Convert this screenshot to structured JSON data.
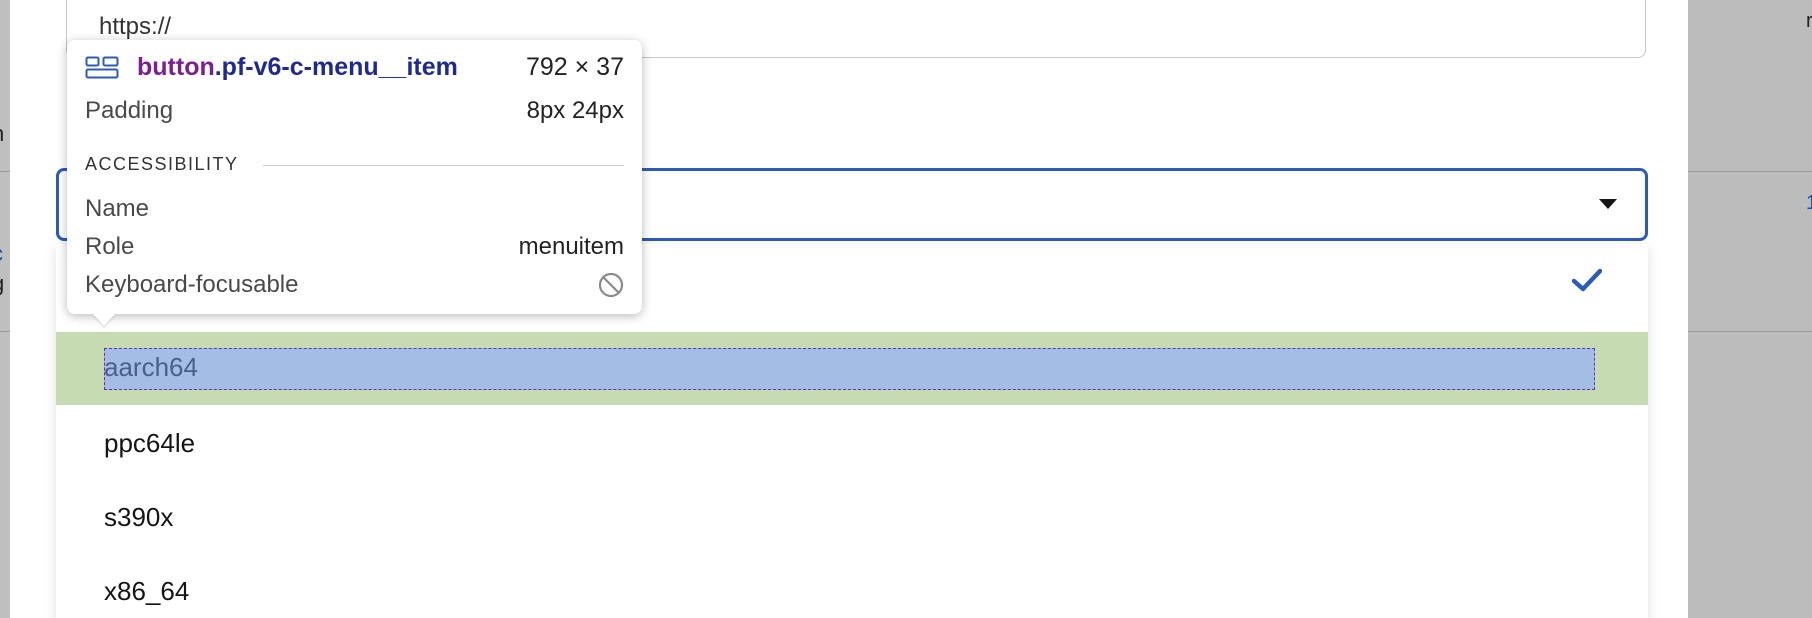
{
  "background": {
    "left_fragments": [
      "n",
      "c",
      "g"
    ],
    "right_fragments": [
      "r",
      "1"
    ]
  },
  "url_input": {
    "value": "https://"
  },
  "arch_select": {
    "selected_value": "",
    "options": [
      {
        "label": "",
        "selected": true
      },
      {
        "label": "aarch64",
        "selected": false,
        "highlighted": true
      },
      {
        "label": "ppc64le",
        "selected": false
      },
      {
        "label": "s390x",
        "selected": false
      },
      {
        "label": "x86_64",
        "selected": false
      }
    ]
  },
  "inspect_tooltip": {
    "selector_tag": "button",
    "selector_class": ".pf-v6-c-menu__item",
    "size": "792 × 37",
    "padding_label": "Padding",
    "padding_value": "8px 24px",
    "section_title": "ACCESSIBILITY",
    "name_label": "Name",
    "name_value": "",
    "role_label": "Role",
    "role_value": "menuitem",
    "focusable_label": "Keyboard-focusable",
    "focusable_icon": "not-allowed-icon"
  },
  "colors": {
    "focus_border": "#2d5bb8",
    "check": "#2d5bb8",
    "highlight_margin": "#c6dbb2",
    "highlight_content": "#a4bde4",
    "selector_tag": "#7a1f8f",
    "selector_class": "#1e2a8c"
  }
}
